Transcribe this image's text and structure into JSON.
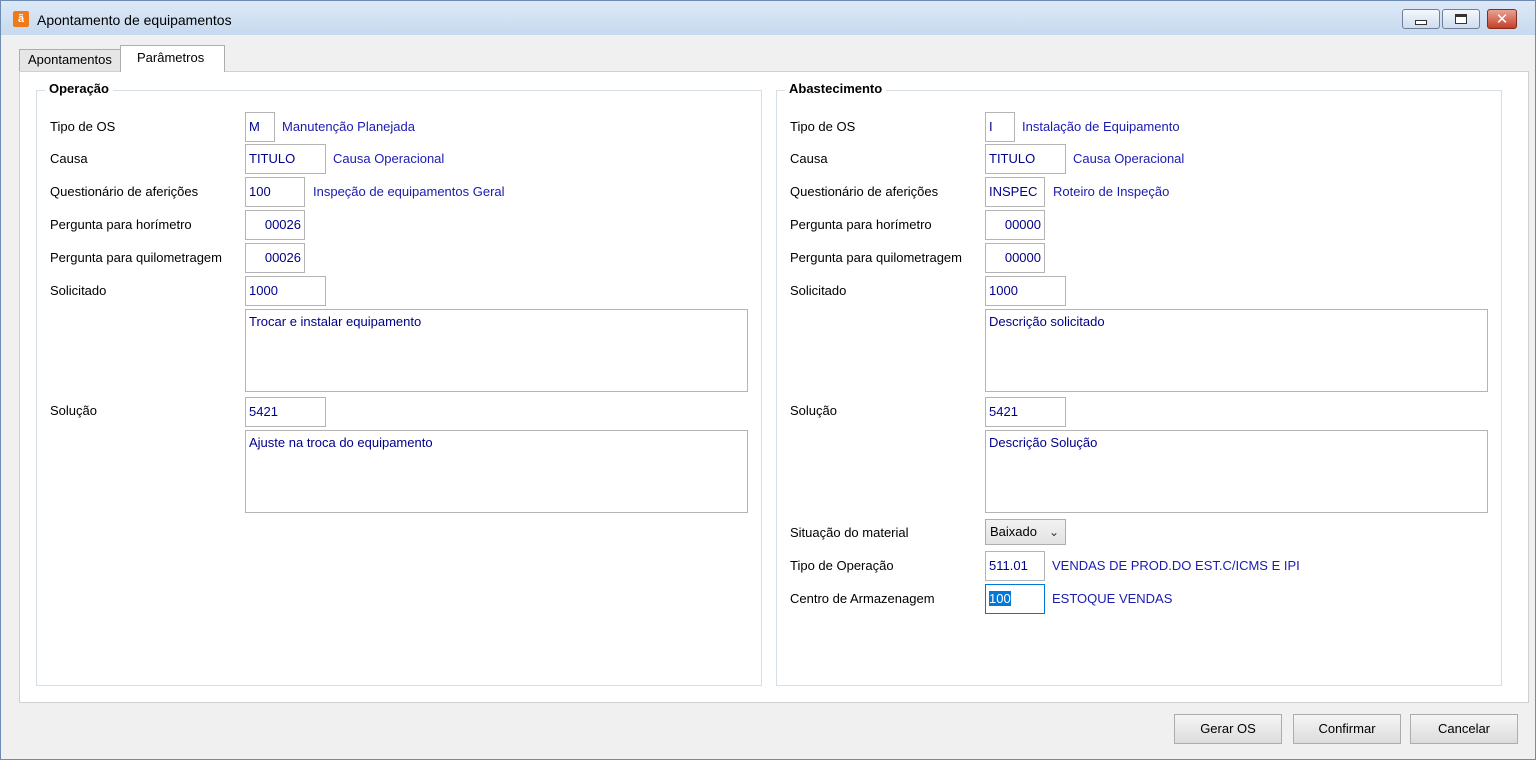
{
  "window": {
    "title": "Apontamento de equipamentos",
    "icon": "app-logo-icon"
  },
  "tabs": [
    "Apontamentos",
    "Parâmetros"
  ],
  "operacao": {
    "title": "Operação",
    "tipo_os_label": "Tipo de OS",
    "tipo_os_value": "M",
    "tipo_os_desc": "Manutenção Planejada",
    "causa_label": "Causa",
    "causa_value": "TITULO",
    "causa_desc": "Causa Operacional",
    "questionario_label": "Questionário de aferições",
    "questionario_value": "100",
    "questionario_desc": "Inspeção de equipamentos Geral",
    "pergunta_horimetro_label": "Pergunta para horímetro",
    "pergunta_horimetro_value": "00026",
    "pergunta_quilometragem_label": "Pergunta para quilometragem",
    "pergunta_quilometragem_value": "00026",
    "solicitado_label": "Solicitado",
    "solicitado_value": "1000",
    "solicitado_text": "Trocar e instalar equipamento",
    "solucao_label": "Solução",
    "solucao_value": "5421",
    "solucao_text": "Ajuste na troca do equipamento"
  },
  "abastecimento": {
    "title": "Abastecimento",
    "tipo_os_label": "Tipo de OS",
    "tipo_os_value": "I",
    "tipo_os_desc": "Instalação de Equipamento",
    "causa_label": "Causa",
    "causa_value": "TITULO",
    "causa_desc": "Causa Operacional",
    "questionario_label": "Questionário de aferições",
    "questionario_value": "INSPEC",
    "questionario_desc": "Roteiro de Inspeção",
    "pergunta_horimetro_label": "Pergunta para horímetro",
    "pergunta_horimetro_value": "00000",
    "pergunta_quilometragem_label": "Pergunta para quilometragem",
    "pergunta_quilometragem_value": "00000",
    "solicitado_label": "Solicitado",
    "solicitado_value": "1000",
    "solicitado_text": "Descrição solicitado",
    "solucao_label": "Solução",
    "solucao_value": "5421",
    "solucao_text": "Descrição Solução",
    "situacao_label": "Situação do material",
    "situacao_value": "Baixado",
    "tipo_operacao_label": "Tipo de Operação",
    "tipo_operacao_value": "511.01",
    "tipo_operacao_desc": "VENDAS DE PROD.DO EST.C/ICMS E IPI",
    "centro_label": "Centro de Armazenagem",
    "centro_value": "100",
    "centro_desc": "ESTOQUE VENDAS"
  },
  "buttons": {
    "gerar_os": "Gerar OS",
    "confirmar": "Confirmar",
    "cancelar": "Cancelar"
  }
}
